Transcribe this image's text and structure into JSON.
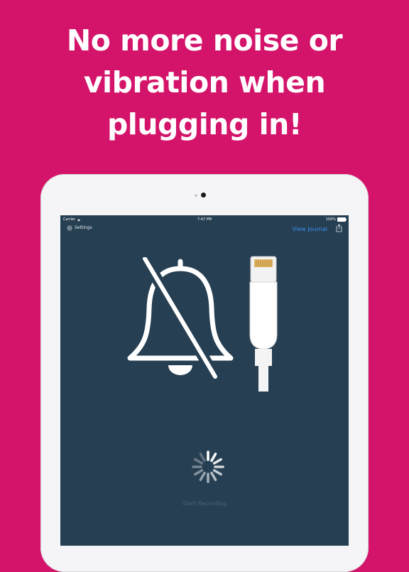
{
  "headline": {
    "line1": "No more noise or",
    "line2": "vibration when",
    "line3": "plugging in!"
  },
  "statusbar": {
    "carrier": "Carrier",
    "time": "7:47 PM",
    "battery": "100%"
  },
  "navbar": {
    "settings_label": "Settings",
    "view_journal_label": "View Journal"
  },
  "main": {
    "start_recording_label": "Start Recording"
  },
  "icons": {
    "settings": "gear-icon",
    "share": "share-icon",
    "mute": "muted-bell-icon",
    "cable": "lightning-cable-icon",
    "spinner": "spinner-icon"
  },
  "colors": {
    "background": "#d4146a",
    "screen": "#263f52",
    "accent": "#3b8ff0",
    "device": "#f5f5f7"
  }
}
